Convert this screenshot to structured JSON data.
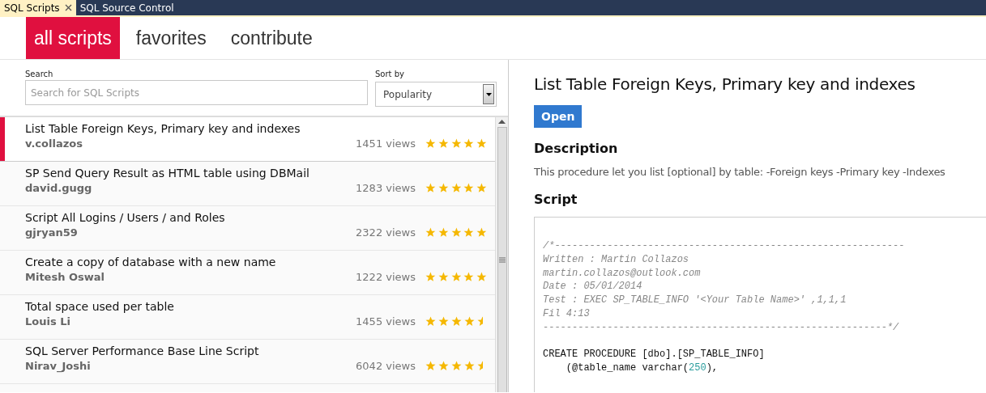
{
  "document_tabs": [
    {
      "label": "SQL Scripts",
      "selected": true
    },
    {
      "label": "SQL Source Control",
      "selected": false
    }
  ],
  "nav_tabs": [
    {
      "label": "all scripts",
      "selected": true
    },
    {
      "label": "favorites",
      "selected": false
    },
    {
      "label": "contribute",
      "selected": false
    }
  ],
  "search": {
    "label": "Search",
    "placeholder": "Search for SQL Scripts"
  },
  "sort": {
    "label": "Sort by",
    "value": "Popularity"
  },
  "scripts": [
    {
      "title": "List Table Foreign Keys, Primary key and indexes",
      "author": "v.collazos",
      "views": "1451 views",
      "stars": 5,
      "selected": true
    },
    {
      "title": "SP Send Query Result as HTML table using DBMail",
      "author": "david.gugg",
      "views": "1283 views",
      "stars": 5,
      "selected": false
    },
    {
      "title": "Script All Logins / Users / and Roles",
      "author": "gjryan59",
      "views": "2322 views",
      "stars": 5,
      "selected": false
    },
    {
      "title": "Create a copy of database with a new name",
      "author": "Mitesh Oswal",
      "views": "1222 views",
      "stars": 5,
      "selected": false
    },
    {
      "title": "Total space used per table",
      "author": "Louis Li",
      "views": "1455 views",
      "stars": 4.5,
      "selected": false
    },
    {
      "title": "SQL Server Performance Base Line Script",
      "author": "Nirav_Joshi",
      "views": "6042 views",
      "stars": 4.5,
      "selected": false
    }
  ],
  "detail": {
    "title": "List Table Foreign Keys, Primary key and indexes",
    "open_button": "Open",
    "description_heading": "Description",
    "description": "This procedure let you list [optional] by table: -Foreign keys -Primary key -Indexes",
    "script_heading": "Script",
    "code": [
      {
        "kind": "line",
        "segments": [
          {
            "kind": "comment",
            "text": "/*------------------------------------------------------------"
          }
        ]
      },
      {
        "kind": "line",
        "segments": [
          {
            "kind": "comment",
            "text": "Written : Martin Collazos"
          }
        ]
      },
      {
        "kind": "line",
        "segments": [
          {
            "kind": "comment",
            "text": "martin.collazos@outlook.com"
          }
        ]
      },
      {
        "kind": "line",
        "segments": [
          {
            "kind": "comment",
            "text": "Date : 05/01/2014"
          }
        ]
      },
      {
        "kind": "line",
        "segments": [
          {
            "kind": "comment",
            "text": "Test : EXEC SP_TABLE_INFO '<Your Table Name>' ,1,1,1"
          }
        ]
      },
      {
        "kind": "line",
        "segments": [
          {
            "kind": "comment",
            "text": "Fil 4:13"
          }
        ]
      },
      {
        "kind": "line",
        "segments": [
          {
            "kind": "comment",
            "text": "-----------------------------------------------------------*/"
          }
        ]
      },
      {
        "kind": "blank"
      },
      {
        "kind": "line",
        "segments": [
          {
            "kind": "plain",
            "text": "CREATE PROCEDURE [dbo].[SP_TABLE_INFO]"
          }
        ]
      },
      {
        "kind": "line",
        "segments": [
          {
            "kind": "plain",
            "text": "    (@table_name varchar("
          },
          {
            "kind": "number",
            "text": "250"
          },
          {
            "kind": "plain",
            "text": "),"
          }
        ]
      }
    ]
  }
}
